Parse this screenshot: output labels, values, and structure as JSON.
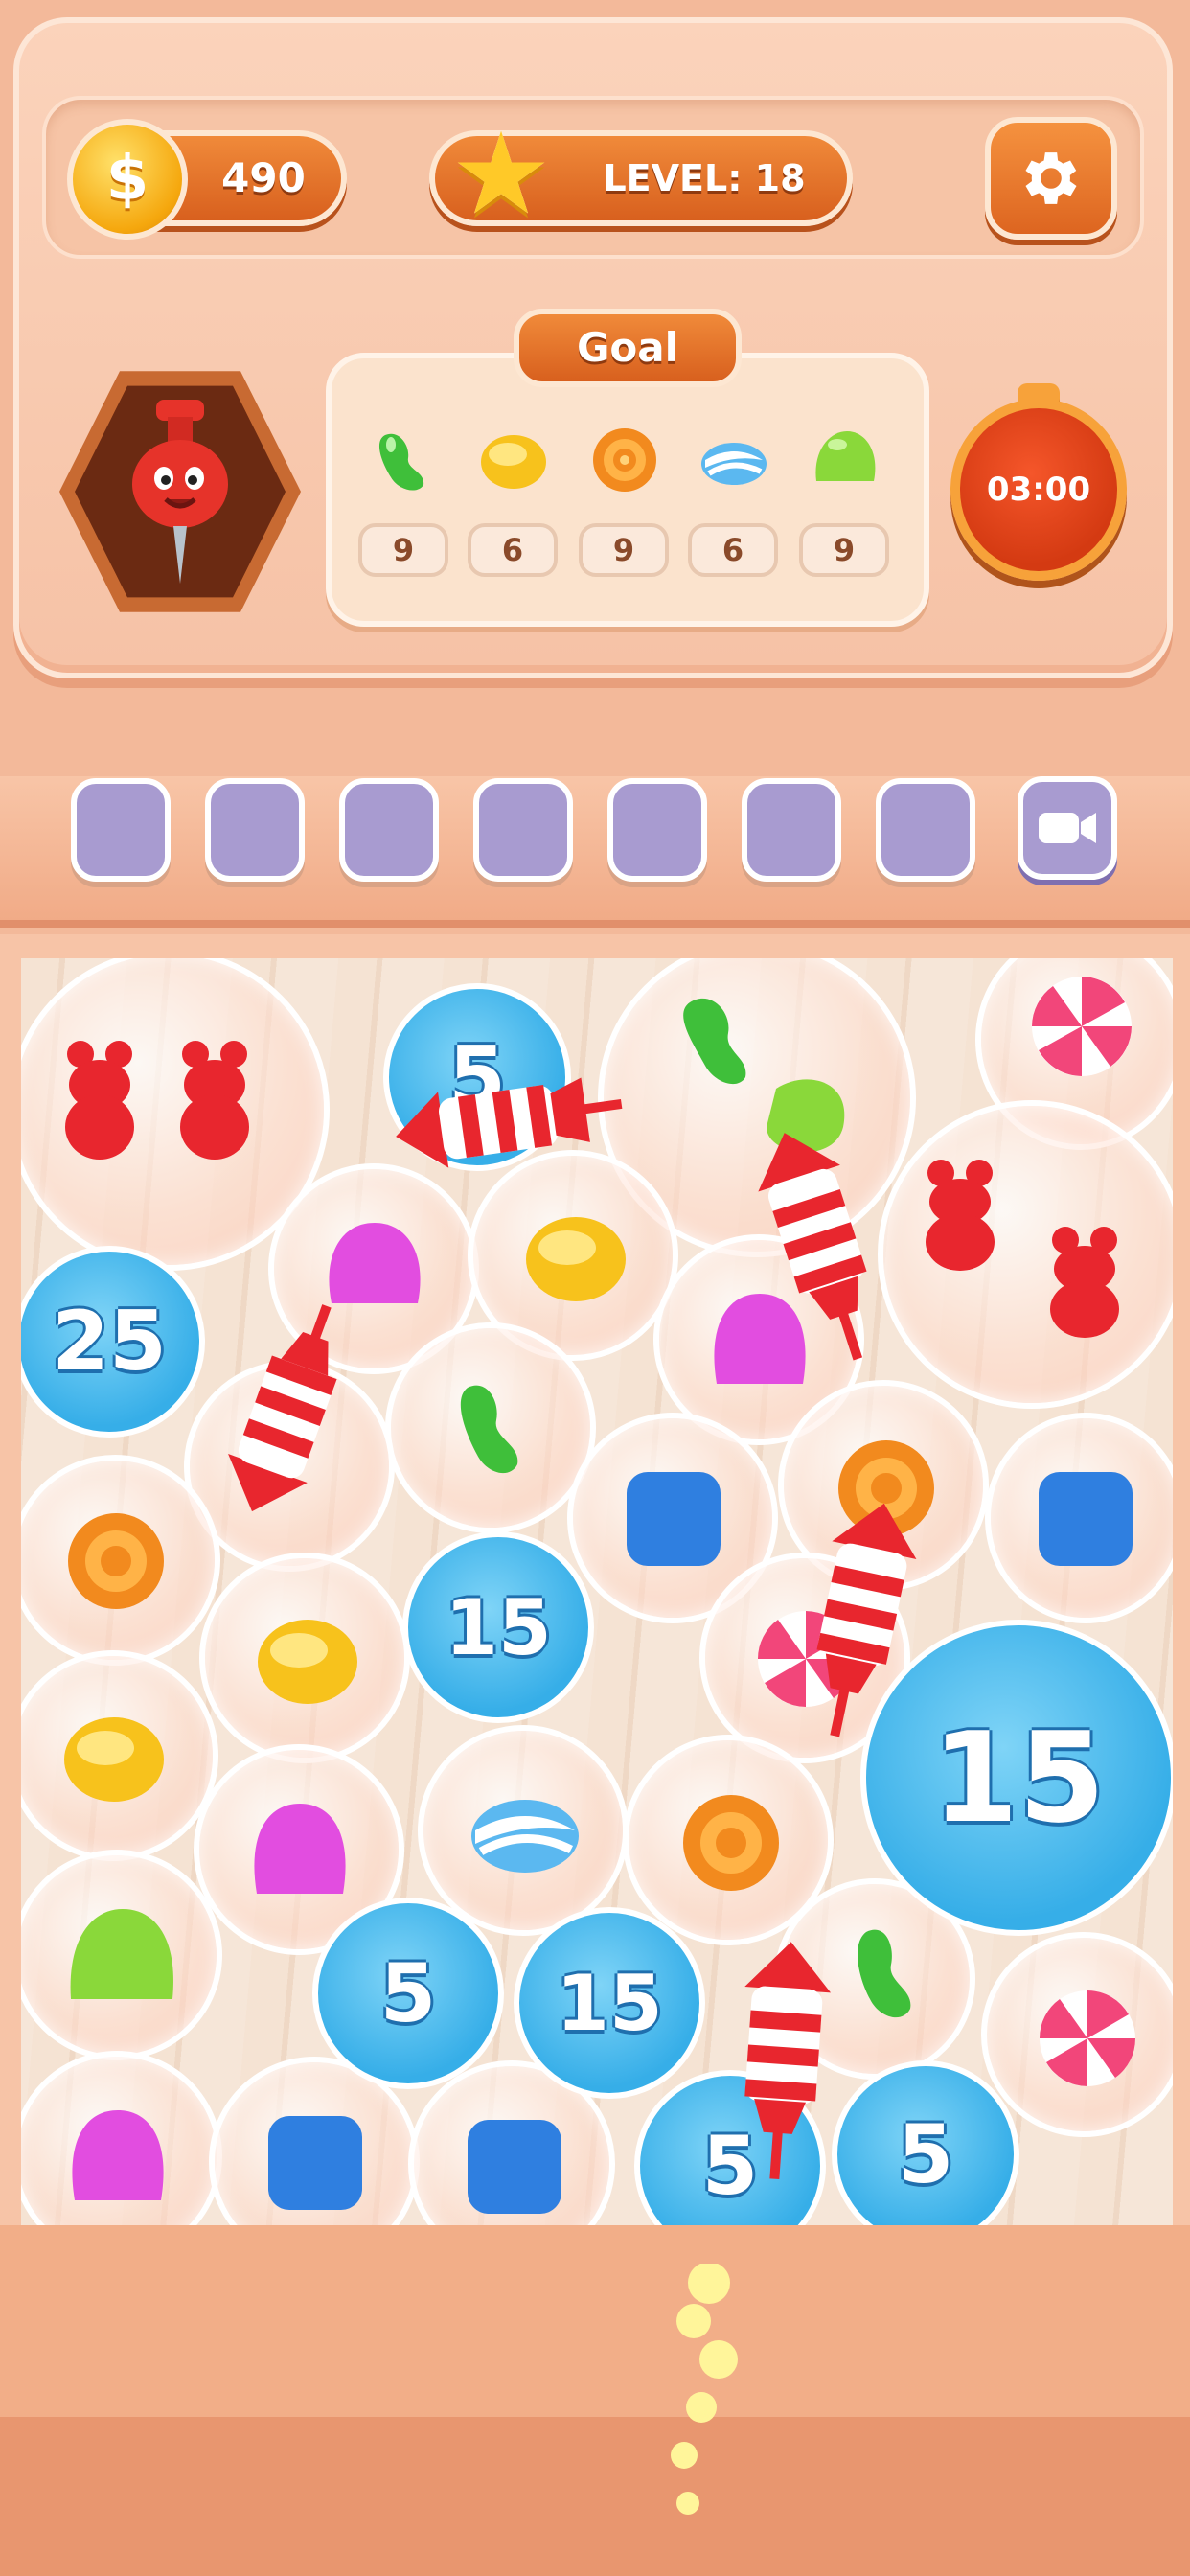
{
  "hud": {
    "coins": "490",
    "level": "LEVEL: 18",
    "goal_label": "Goal",
    "timer": "03:00",
    "goals": [
      {
        "candy": "green-jellybean",
        "count": "9",
        "color": "#3fbf3a"
      },
      {
        "candy": "yellow-round-candy",
        "count": "6",
        "color": "#f7c21c"
      },
      {
        "candy": "orange-swirl-candy",
        "count": "9",
        "color": "#f28a1e"
      },
      {
        "candy": "blue-wrapped-candy",
        "count": "6",
        "color": "#5bb8f0"
      },
      {
        "candy": "green-gumdrop",
        "count": "9",
        "color": "#8ad83a"
      }
    ]
  },
  "slots": {
    "count": 7,
    "video_slot_icon": "video-camera-icon"
  },
  "board": {
    "number_bubbles": [
      "25",
      "5",
      "15",
      "15",
      "5",
      "15",
      "5",
      "5"
    ],
    "rockets": 5
  },
  "colors": {
    "accent_orange": "#e07028",
    "bubble_blue": "#36aee8",
    "slot_purple": "#a89bd0"
  }
}
